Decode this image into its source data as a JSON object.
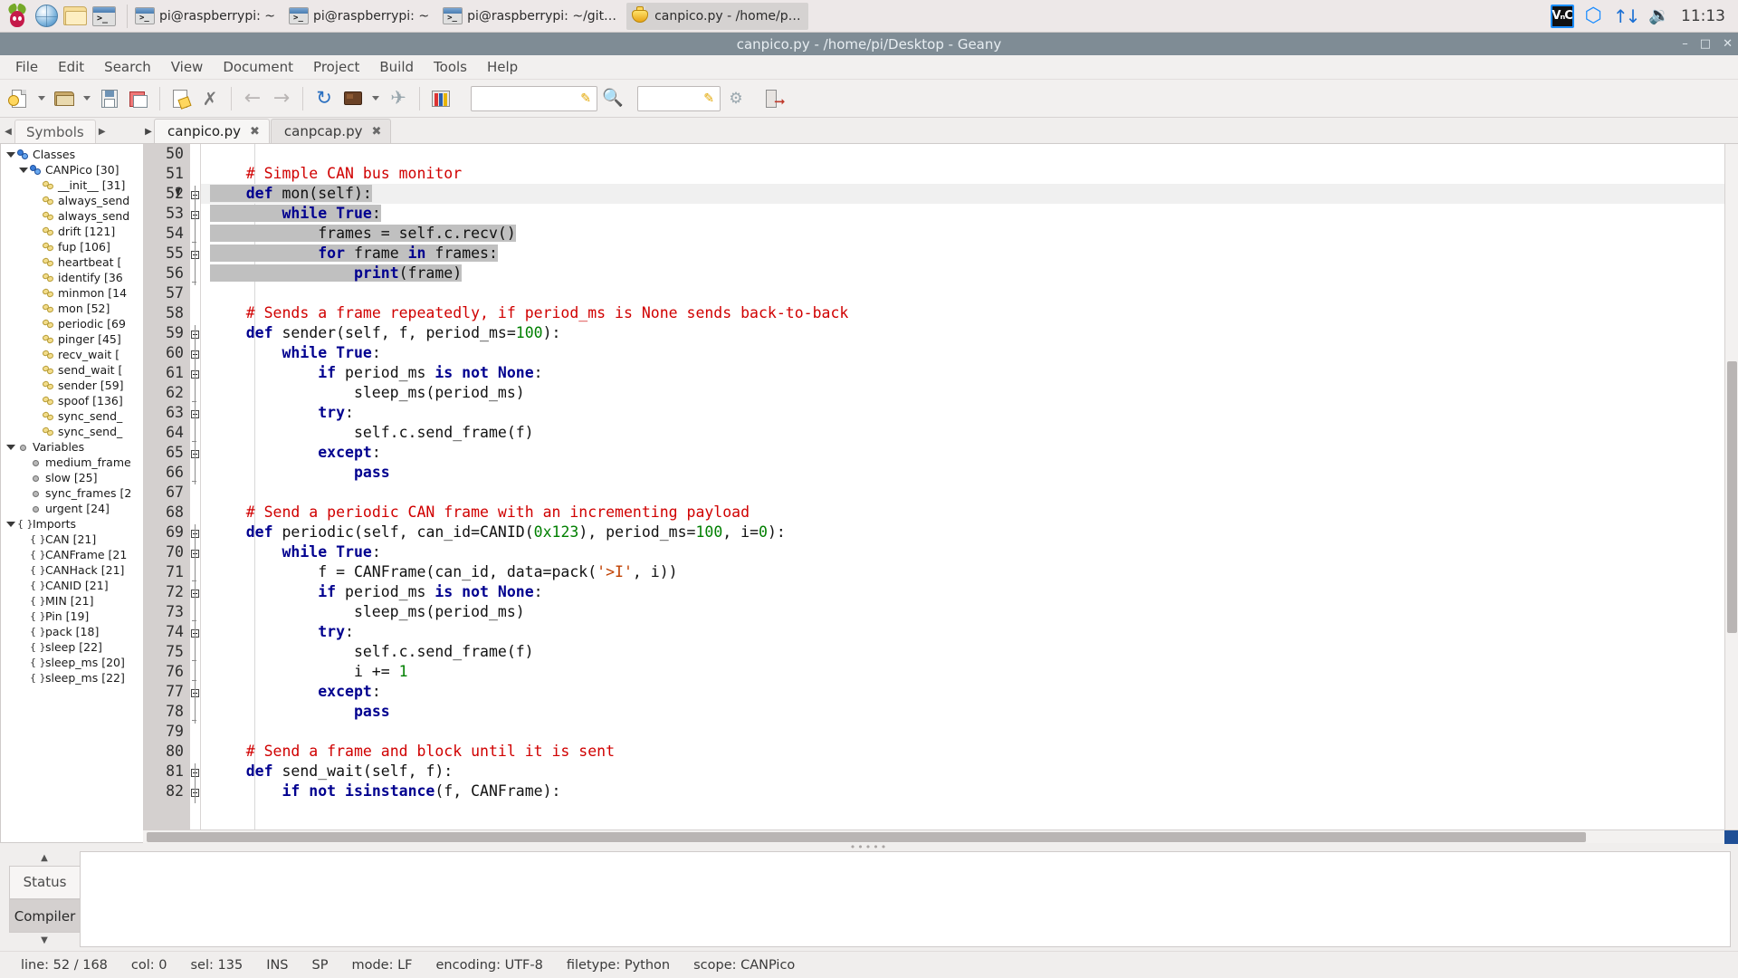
{
  "taskbar": {
    "launchers": [
      {
        "name": "raspberry-menu-icon",
        "label": "Raspberry Pi Menu"
      },
      {
        "name": "web-browser-icon",
        "label": "Web Browser"
      },
      {
        "name": "file-manager-icon",
        "label": "File Manager"
      },
      {
        "name": "terminal-icon",
        "label": "Terminal"
      }
    ],
    "tasks": [
      {
        "label": "pi@raspberrypi: ~",
        "icon": "terminal-icon",
        "active": false
      },
      {
        "label": "pi@raspberrypi: ~",
        "icon": "terminal-icon",
        "active": false
      },
      {
        "label": "pi@raspberrypi: ~/git…",
        "icon": "terminal-icon",
        "active": false
      },
      {
        "label": "canpico.py - /home/p…",
        "icon": "geany-icon",
        "active": true
      }
    ],
    "tray": {
      "vnc_label": "VₙC",
      "bluetooth_icon": "bluetooth-icon",
      "network_icon": "network-updown-icon",
      "volume_icon": "volume-icon",
      "clock": "11:13"
    }
  },
  "window": {
    "title": "canpico.py - /home/pi/Desktop - Geany",
    "buttons": {
      "minimize": "–",
      "maximize": "□",
      "close": "✕"
    }
  },
  "menubar": [
    {
      "label": "File"
    },
    {
      "label": "Edit"
    },
    {
      "label": "Search"
    },
    {
      "label": "View"
    },
    {
      "label": "Document"
    },
    {
      "label": "Project"
    },
    {
      "label": "Build"
    },
    {
      "label": "Tools"
    },
    {
      "label": "Help"
    }
  ],
  "toolbar": {
    "items": [
      {
        "name": "new-document-button"
      },
      {
        "name": "new-document-dropdown"
      },
      {
        "name": "open-file-button"
      },
      {
        "name": "open-file-dropdown"
      },
      {
        "name": "save-file-button"
      },
      {
        "name": "save-all-button"
      },
      {
        "name": "revert-file-button"
      },
      {
        "name": "close-file-button"
      },
      {
        "name": "navigate-back-button"
      },
      {
        "name": "navigate-forward-button"
      },
      {
        "name": "compile-button"
      },
      {
        "name": "build-button"
      },
      {
        "name": "build-dropdown"
      },
      {
        "name": "run-button"
      },
      {
        "name": "color-chooser-button"
      },
      {
        "name": "search-input"
      },
      {
        "name": "search-submit-button"
      },
      {
        "name": "goto-line-input"
      },
      {
        "name": "goto-line-button"
      },
      {
        "name": "quit-button"
      }
    ],
    "search_value": "",
    "search_placeholder": "",
    "goto_value": "",
    "goto_placeholder": ""
  },
  "sidebar": {
    "tab": "Symbols",
    "tree": [
      {
        "label": "Classes",
        "icon": "class-icon",
        "depth": 0,
        "expander": "down"
      },
      {
        "label": "CANPico [30]",
        "icon": "class-icon",
        "depth": 1,
        "expander": "down"
      },
      {
        "label": "__init__ [31]",
        "icon": "method-icon",
        "depth": 2
      },
      {
        "label": "always_send",
        "icon": "method-icon",
        "depth": 2
      },
      {
        "label": "always_send",
        "icon": "method-icon",
        "depth": 2
      },
      {
        "label": "drift [121]",
        "icon": "method-icon",
        "depth": 2
      },
      {
        "label": "fup [106]",
        "icon": "method-icon",
        "depth": 2
      },
      {
        "label": "heartbeat [",
        "icon": "method-icon",
        "depth": 2
      },
      {
        "label": "identify [36",
        "icon": "method-icon",
        "depth": 2
      },
      {
        "label": "minmon [14",
        "icon": "method-icon",
        "depth": 2
      },
      {
        "label": "mon [52]",
        "icon": "method-icon",
        "depth": 2
      },
      {
        "label": "periodic [69",
        "icon": "method-icon",
        "depth": 2
      },
      {
        "label": "pinger [45]",
        "icon": "method-icon",
        "depth": 2
      },
      {
        "label": "recv_wait [",
        "icon": "method-icon",
        "depth": 2
      },
      {
        "label": "send_wait [",
        "icon": "method-icon",
        "depth": 2
      },
      {
        "label": "sender [59]",
        "icon": "method-icon",
        "depth": 2
      },
      {
        "label": "spoof [136]",
        "icon": "method-icon",
        "depth": 2
      },
      {
        "label": "sync_send_",
        "icon": "method-icon",
        "depth": 2
      },
      {
        "label": "sync_send_",
        "icon": "method-icon",
        "depth": 2
      },
      {
        "label": "Variables",
        "icon": "variable-icon",
        "depth": 0,
        "expander": "down"
      },
      {
        "label": "medium_frame",
        "icon": "variable-icon",
        "depth": 1
      },
      {
        "label": "slow [25]",
        "icon": "variable-icon",
        "depth": 1
      },
      {
        "label": "sync_frames [2",
        "icon": "variable-icon",
        "depth": 1
      },
      {
        "label": "urgent [24]",
        "icon": "variable-icon",
        "depth": 1
      },
      {
        "label": "Imports",
        "icon": "import-icon",
        "depth": 0,
        "expander": "down"
      },
      {
        "label": "CAN [21]",
        "icon": "import-icon",
        "depth": 1
      },
      {
        "label": "CANFrame [21",
        "icon": "import-icon",
        "depth": 1
      },
      {
        "label": "CANHack [21]",
        "icon": "import-icon",
        "depth": 1
      },
      {
        "label": "CANID [21]",
        "icon": "import-icon",
        "depth": 1
      },
      {
        "label": "MIN [21]",
        "icon": "import-icon",
        "depth": 1
      },
      {
        "label": "Pin [19]",
        "icon": "import-icon",
        "depth": 1
      },
      {
        "label": "pack [18]",
        "icon": "import-icon",
        "depth": 1
      },
      {
        "label": "sleep [22]",
        "icon": "import-icon",
        "depth": 1
      },
      {
        "label": "sleep_ms [20]",
        "icon": "import-icon",
        "depth": 1
      },
      {
        "label": "sleep_ms [22]",
        "icon": "import-icon",
        "depth": 1
      }
    ]
  },
  "editor": {
    "tabs": [
      {
        "label": "canpico.py",
        "active": true,
        "close": "✖"
      },
      {
        "label": "canpcap.py",
        "active": false,
        "close": "✖"
      }
    ],
    "first_line": 50,
    "lines": [
      {
        "n": 50,
        "fold": null,
        "tokens": []
      },
      {
        "n": 51,
        "fold": null,
        "tokens": [
          {
            "t": "    ",
            "c": "pl"
          },
          {
            "t": "# Simple CAN bus monitor",
            "c": "cm"
          }
        ]
      },
      {
        "n": 52,
        "fold": "box",
        "sel": true,
        "cur": true,
        "tokens": [
          {
            "t": "    ",
            "c": "pl"
          },
          {
            "t": "def",
            "c": "k"
          },
          {
            "t": " mon(self):",
            "c": "pl"
          }
        ]
      },
      {
        "n": 53,
        "fold": "box",
        "sel": true,
        "tokens": [
          {
            "t": "        ",
            "c": "pl"
          },
          {
            "t": "while",
            "c": "k"
          },
          {
            "t": " ",
            "c": "pl"
          },
          {
            "t": "True",
            "c": "k"
          },
          {
            "t": ":",
            "c": "pl"
          }
        ]
      },
      {
        "n": 54,
        "fold": "line",
        "sel": true,
        "tokens": [
          {
            "t": "            frames = self.c.recv()",
            "c": "pl"
          }
        ]
      },
      {
        "n": 55,
        "fold": "box",
        "sel": true,
        "tokens": [
          {
            "t": "            ",
            "c": "pl"
          },
          {
            "t": "for",
            "c": "k"
          },
          {
            "t": " frame ",
            "c": "pl"
          },
          {
            "t": "in",
            "c": "k"
          },
          {
            "t": " frames:",
            "c": "pl"
          }
        ]
      },
      {
        "n": 56,
        "fold": "line",
        "sel": true,
        "tokens": [
          {
            "t": "                ",
            "c": "pl"
          },
          {
            "t": "print",
            "c": "k"
          },
          {
            "t": "(frame)",
            "c": "pl"
          }
        ]
      },
      {
        "n": 57,
        "fold": null,
        "tokens": []
      },
      {
        "n": 58,
        "fold": null,
        "tokens": [
          {
            "t": "    ",
            "c": "pl"
          },
          {
            "t": "# Sends a frame repeatedly, if period_ms is None sends back-to-back",
            "c": "cm"
          }
        ]
      },
      {
        "n": 59,
        "fold": "box",
        "tokens": [
          {
            "t": "    ",
            "c": "pl"
          },
          {
            "t": "def",
            "c": "k"
          },
          {
            "t": " sender(self, f, period_ms=",
            "c": "pl"
          },
          {
            "t": "100",
            "c": "nm"
          },
          {
            "t": "):",
            "c": "pl"
          }
        ]
      },
      {
        "n": 60,
        "fold": "box",
        "tokens": [
          {
            "t": "        ",
            "c": "pl"
          },
          {
            "t": "while",
            "c": "k"
          },
          {
            "t": " ",
            "c": "pl"
          },
          {
            "t": "True",
            "c": "k"
          },
          {
            "t": ":",
            "c": "pl"
          }
        ]
      },
      {
        "n": 61,
        "fold": "box",
        "tokens": [
          {
            "t": "            ",
            "c": "pl"
          },
          {
            "t": "if",
            "c": "k"
          },
          {
            "t": " period_ms ",
            "c": "pl"
          },
          {
            "t": "is not",
            "c": "k"
          },
          {
            "t": " ",
            "c": "pl"
          },
          {
            "t": "None",
            "c": "k"
          },
          {
            "t": ":",
            "c": "pl"
          }
        ]
      },
      {
        "n": 62,
        "fold": "line",
        "tokens": [
          {
            "t": "                sleep_ms(period_ms)",
            "c": "pl"
          }
        ]
      },
      {
        "n": 63,
        "fold": "box",
        "tokens": [
          {
            "t": "            ",
            "c": "pl"
          },
          {
            "t": "try",
            "c": "k"
          },
          {
            "t": ":",
            "c": "pl"
          }
        ]
      },
      {
        "n": 64,
        "fold": "line",
        "tokens": [
          {
            "t": "                self.c.send_frame(f)",
            "c": "pl"
          }
        ]
      },
      {
        "n": 65,
        "fold": "box",
        "tokens": [
          {
            "t": "            ",
            "c": "pl"
          },
          {
            "t": "except",
            "c": "k"
          },
          {
            "t": ":",
            "c": "pl"
          }
        ]
      },
      {
        "n": 66,
        "fold": "line",
        "tokens": [
          {
            "t": "                ",
            "c": "pl"
          },
          {
            "t": "pass",
            "c": "k"
          }
        ]
      },
      {
        "n": 67,
        "fold": null,
        "tokens": []
      },
      {
        "n": 68,
        "fold": null,
        "tokens": [
          {
            "t": "    ",
            "c": "pl"
          },
          {
            "t": "# Send a periodic CAN frame with an incrementing payload",
            "c": "cm"
          }
        ]
      },
      {
        "n": 69,
        "fold": "box",
        "tokens": [
          {
            "t": "    ",
            "c": "pl"
          },
          {
            "t": "def",
            "c": "k"
          },
          {
            "t": " periodic(self, can_id=CANID(",
            "c": "pl"
          },
          {
            "t": "0x123",
            "c": "nm"
          },
          {
            "t": "), period_ms=",
            "c": "pl"
          },
          {
            "t": "100",
            "c": "nm"
          },
          {
            "t": ", i=",
            "c": "pl"
          },
          {
            "t": "0",
            "c": "nm"
          },
          {
            "t": "):",
            "c": "pl"
          }
        ]
      },
      {
        "n": 70,
        "fold": "box",
        "tokens": [
          {
            "t": "        ",
            "c": "pl"
          },
          {
            "t": "while",
            "c": "k"
          },
          {
            "t": " ",
            "c": "pl"
          },
          {
            "t": "True",
            "c": "k"
          },
          {
            "t": ":",
            "c": "pl"
          }
        ]
      },
      {
        "n": 71,
        "fold": "line",
        "tokens": [
          {
            "t": "            f = CANFrame(can_id, data=pack(",
            "c": "pl"
          },
          {
            "t": "'>I'",
            "c": "st"
          },
          {
            "t": ", i))",
            "c": "pl"
          }
        ]
      },
      {
        "n": 72,
        "fold": "box",
        "tokens": [
          {
            "t": "            ",
            "c": "pl"
          },
          {
            "t": "if",
            "c": "k"
          },
          {
            "t": " period_ms ",
            "c": "pl"
          },
          {
            "t": "is not",
            "c": "k"
          },
          {
            "t": " ",
            "c": "pl"
          },
          {
            "t": "None",
            "c": "k"
          },
          {
            "t": ":",
            "c": "pl"
          }
        ]
      },
      {
        "n": 73,
        "fold": "line",
        "tokens": [
          {
            "t": "                sleep_ms(period_ms)",
            "c": "pl"
          }
        ]
      },
      {
        "n": 74,
        "fold": "box",
        "tokens": [
          {
            "t": "            ",
            "c": "pl"
          },
          {
            "t": "try",
            "c": "k"
          },
          {
            "t": ":",
            "c": "pl"
          }
        ]
      },
      {
        "n": 75,
        "fold": "line",
        "tokens": [
          {
            "t": "                self.c.send_frame(f)",
            "c": "pl"
          }
        ]
      },
      {
        "n": 76,
        "fold": "line",
        "tokens": [
          {
            "t": "                i += ",
            "c": "pl"
          },
          {
            "t": "1",
            "c": "nm"
          }
        ]
      },
      {
        "n": 77,
        "fold": "box",
        "tokens": [
          {
            "t": "            ",
            "c": "pl"
          },
          {
            "t": "except",
            "c": "k"
          },
          {
            "t": ":",
            "c": "pl"
          }
        ]
      },
      {
        "n": 78,
        "fold": "line",
        "tokens": [
          {
            "t": "                ",
            "c": "pl"
          },
          {
            "t": "pass",
            "c": "k"
          }
        ]
      },
      {
        "n": 79,
        "fold": null,
        "tokens": []
      },
      {
        "n": 80,
        "fold": null,
        "tokens": [
          {
            "t": "    ",
            "c": "pl"
          },
          {
            "t": "# Send a frame and block until it is sent",
            "c": "cm"
          }
        ]
      },
      {
        "n": 81,
        "fold": "box",
        "tokens": [
          {
            "t": "    ",
            "c": "pl"
          },
          {
            "t": "def",
            "c": "k"
          },
          {
            "t": " send_wait(self, f):",
            "c": "pl"
          }
        ]
      },
      {
        "n": 82,
        "fold": "box",
        "tokens": [
          {
            "t": "        ",
            "c": "pl"
          },
          {
            "t": "if not",
            "c": "k"
          },
          {
            "t": " ",
            "c": "pl"
          },
          {
            "t": "isinstance",
            "c": "k"
          },
          {
            "t": "(f, CANFrame):",
            "c": "pl"
          }
        ]
      }
    ]
  },
  "message_area": {
    "tabs": [
      {
        "label": "Status",
        "active": false
      },
      {
        "label": "Compiler",
        "active": true
      }
    ],
    "content": ""
  },
  "statusbar": {
    "items": [
      {
        "name": "status-line",
        "text": "line: 52 / 168"
      },
      {
        "name": "status-col",
        "text": "col: 0"
      },
      {
        "name": "status-sel",
        "text": "sel: 135"
      },
      {
        "name": "status-insert-mode",
        "text": "INS"
      },
      {
        "name": "status-indent-mode",
        "text": "SP"
      },
      {
        "name": "status-eol-mode",
        "text": "mode: LF"
      },
      {
        "name": "status-encoding",
        "text": "encoding: UTF-8"
      },
      {
        "name": "status-filetype",
        "text": "filetype: Python"
      },
      {
        "name": "status-scope",
        "text": "scope: CANPico"
      }
    ]
  },
  "colors": {
    "titlebar": "#7f8c95",
    "keyword": "#00008f",
    "comment": "#d00000",
    "number": "#007f00",
    "string": "#c04000",
    "selection": "#c0c0c0",
    "accent": "#1a8cff"
  }
}
